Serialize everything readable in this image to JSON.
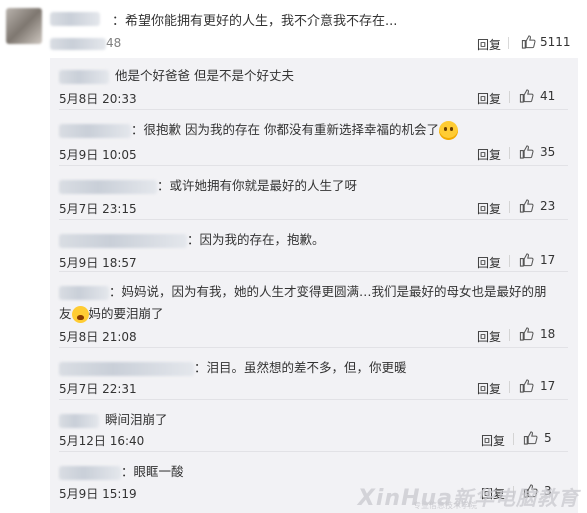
{
  "top_comment": {
    "text": "：希望你能拥有更好的人生，我不介意我不存在...",
    "date_suffix": "48",
    "reply_label": "回复",
    "likes": "5111"
  },
  "replies": [
    {
      "text": "他是个好爸爸 但是不是个好丈夫",
      "date": "5月8日 20:33",
      "reply_label": "回复",
      "likes": "41"
    },
    {
      "text": "：很抱歉 因为我的存在  你都没有重新选择幸福的机会了",
      "date": "5月9日 10:05",
      "reply_label": "回复",
      "likes": "35"
    },
    {
      "text": "：或许她拥有你就是最好的人生了呀",
      "date": "5月7日 23:15",
      "reply_label": "回复",
      "likes": "23"
    },
    {
      "text": "：因为我的存在，抱歉。",
      "date": "5月9日 18:57",
      "reply_label": "回复",
      "likes": "17"
    },
    {
      "text": "：妈妈说，因为有我，她的人生才变得更圆满…我们是最好的母女也是最好的朋",
      "text2a": "友",
      "text2b": "妈的要泪崩了",
      "date": "5月8日 21:08",
      "reply_label": "回复",
      "likes": "18"
    },
    {
      "text": "：泪目。虽然想的差不多，但，你更暖",
      "date": "5月7日 22:31",
      "reply_label": "回复",
      "likes": "17"
    },
    {
      "text": "瞬间泪崩了",
      "date": "5月12日 16:40",
      "reply_label": "回复",
      "likes": "5"
    },
    {
      "text": "：眼眶一酸",
      "date": "5月9日 15:19",
      "reply_label": "回复",
      "likes": "3"
    }
  ],
  "watermark": {
    "latin": "XinHua",
    "cn": "新华电脑教育",
    "sub": "专业信息技术学院"
  },
  "colors": {
    "reply_bg": "#f2f2f5",
    "watermark": "#c8c8cd"
  }
}
